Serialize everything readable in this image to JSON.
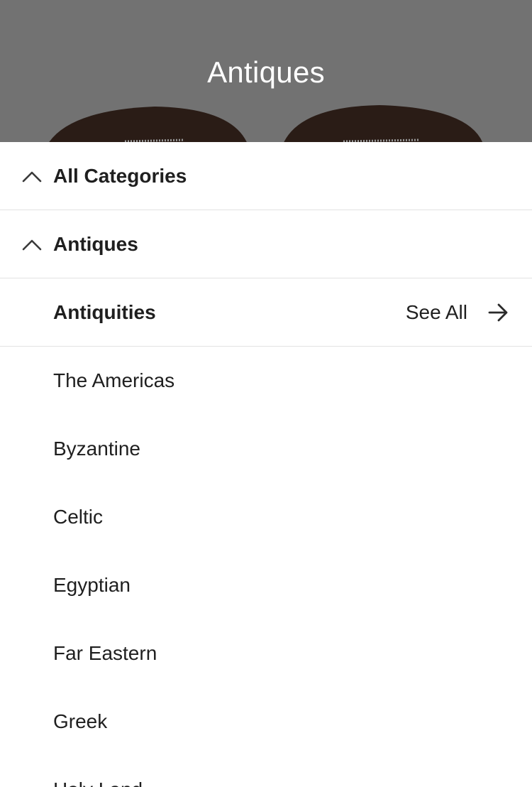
{
  "header": {
    "title": "Antiques"
  },
  "nav": {
    "all_categories": {
      "label": "All Categories",
      "icon": "chevron-up-icon"
    },
    "parent_category": {
      "label": "Antiques",
      "icon": "chevron-up-icon"
    },
    "current_category": {
      "label": "Antiquities",
      "see_all_label": "See All",
      "see_all_icon": "arrow-right-icon"
    }
  },
  "subcategories": [
    "The Americas",
    "Byzantine",
    "Celtic",
    "Egyptian",
    "Far Eastern",
    "Greek",
    "Holy Land"
  ],
  "colors": {
    "hero_background": "#727272",
    "text": "#1f1f1f",
    "divider": "#e2e2e2"
  }
}
